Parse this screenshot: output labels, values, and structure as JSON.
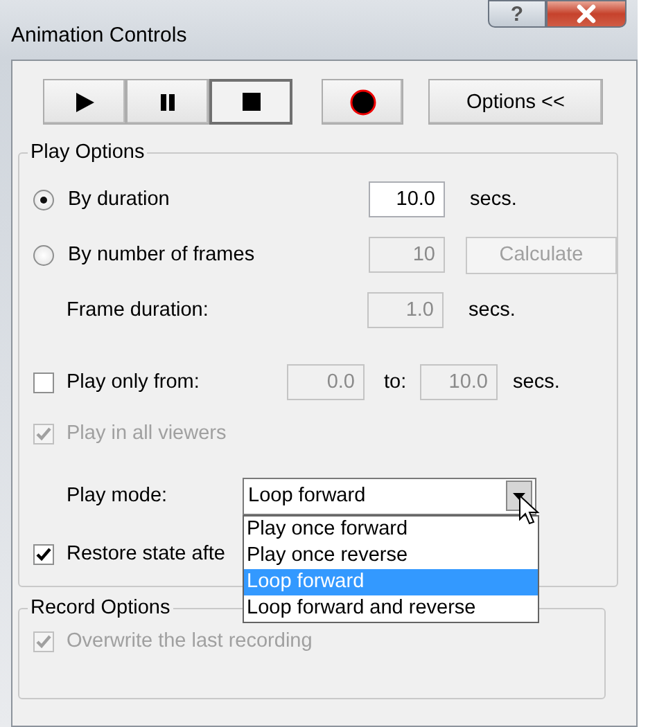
{
  "window": {
    "title": "Animation Controls",
    "help_label": "?"
  },
  "toolbar": [
    {
      "kind": "play",
      "pressed": false
    },
    {
      "kind": "pause",
      "pressed": false
    },
    {
      "kind": "stop",
      "pressed": true
    },
    {
      "kind": "record",
      "pressed": false
    },
    {
      "kind": "text",
      "label": "Options <<",
      "pressed": false
    }
  ],
  "play_options": {
    "title": "Play Options",
    "by_duration": {
      "label": "By duration",
      "selected": true,
      "value": "10.0",
      "unit": "secs."
    },
    "by_frames": {
      "label": "By number of frames",
      "selected": false,
      "value": "10",
      "disabled": true,
      "button": "Calculate"
    },
    "frame_duration": {
      "label": "Frame duration:",
      "value": "1.0",
      "unit": "secs.",
      "disabled": true
    },
    "play_only": {
      "label": "Play only from:",
      "checked": false,
      "from": "0.0",
      "to_label": "to:",
      "to": "10.0",
      "unit": "secs.",
      "disabled": true
    },
    "all_viewers": {
      "label": "Play in all viewers",
      "checked": true,
      "disabled": true
    },
    "play_mode": {
      "label": "Play mode:",
      "value": "Loop forward",
      "expanded": true,
      "options": [
        {
          "label": "Play once forward",
          "selected": false
        },
        {
          "label": "Play once reverse",
          "selected": false
        },
        {
          "label": "Loop forward",
          "selected": true
        },
        {
          "label": "Loop forward and reverse",
          "selected": false
        }
      ]
    },
    "restore": {
      "label": "Restore state afte",
      "checked": true
    }
  },
  "record_options": {
    "title": "Record Options",
    "overwrite": {
      "label": "Overwrite the last recording",
      "checked": true,
      "disabled": true
    }
  }
}
